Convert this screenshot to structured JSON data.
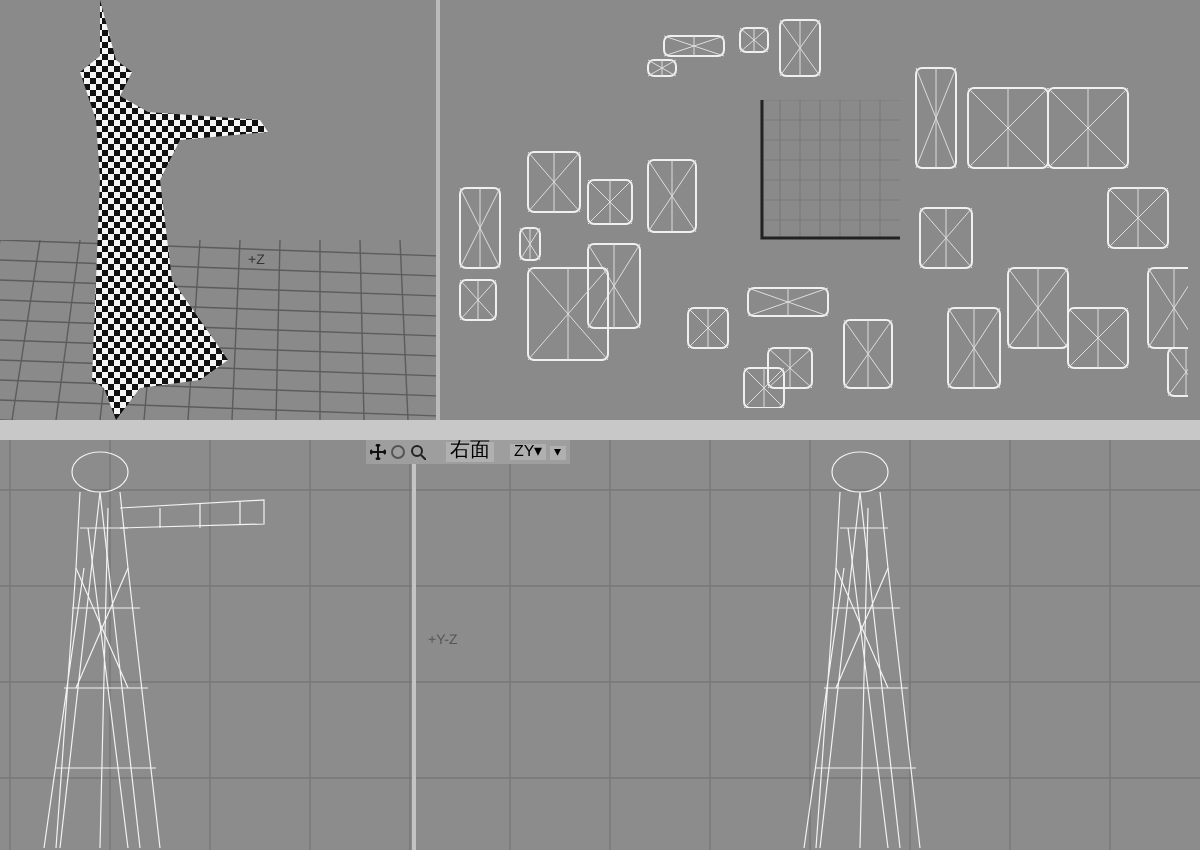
{
  "viewports": [
    {
      "kind": "perspective",
      "axis_label": "+Z"
    },
    {
      "kind": "uv"
    }
  ],
  "toolbar": {
    "view_label": "右面",
    "axis_dropdown": "ZY▾",
    "options_dropdown": "▾"
  },
  "bottom_viewport": {
    "kind": "orthographic",
    "axis_label": "+Y-Z"
  }
}
